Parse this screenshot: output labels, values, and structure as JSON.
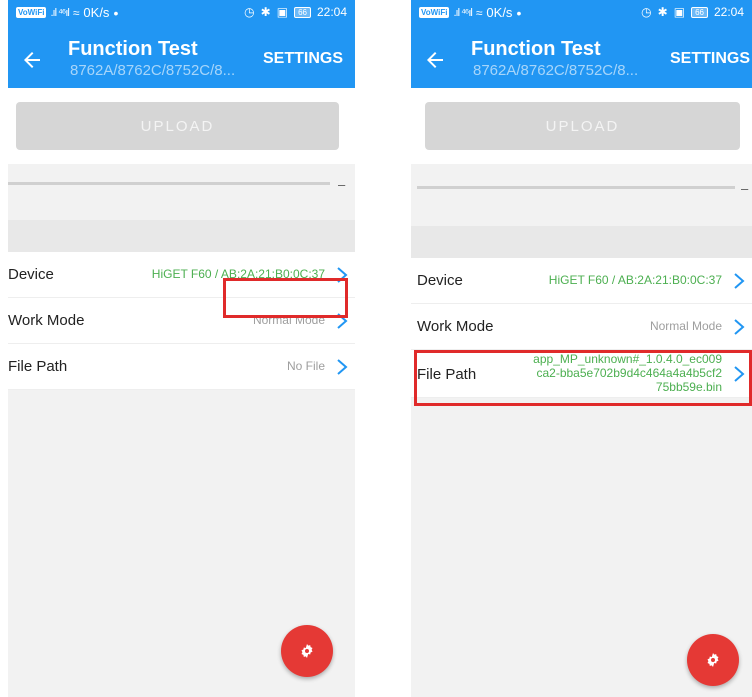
{
  "screens": [
    {
      "status_bar": {
        "volte": "VoWiFi",
        "signal": ".ıl ⁴⁶ıl",
        "net_speed": "0K/s",
        "dot": "•",
        "battery": "66",
        "time": "22:04"
      },
      "app_bar": {
        "title": "Function Test",
        "subtitle": "8762A/8762C/8752C/8...",
        "settings_label": "SETTINGS"
      },
      "upload_label": "UPLOAD",
      "progress_dash": "–",
      "rows": [
        {
          "label": "Device",
          "value": "HiGET F60 / AB:2A:21:B0:0C:37"
        },
        {
          "label": "Work Mode",
          "value": "Normal Mode"
        },
        {
          "label": "File Path",
          "value": "No File"
        }
      ]
    },
    {
      "status_bar": {
        "volte": "VoWiFi",
        "signal": ".ıl ⁴⁶ıl",
        "net_speed": "0K/s",
        "dot": "•",
        "battery": "66",
        "time": "22:04"
      },
      "app_bar": {
        "title": "Function Test",
        "subtitle": "8762A/8762C/8752C/8...",
        "settings_label": "SETTINGS"
      },
      "upload_label": "UPLOAD",
      "progress_dash": "–",
      "rows": [
        {
          "label": "Device",
          "value": "HiGET F60 / AB:2A:21:B0:0C:37"
        },
        {
          "label": "Work Mode",
          "value": "Normal Mode"
        },
        {
          "label": "File Path",
          "value_lines": [
            "app_MP_unknown#_1.0.4.0_ec009",
            "ca2-bba5e702b9d4c464a4a4b5cf2",
            "75bb59e.bin"
          ]
        }
      ]
    }
  ],
  "colors": {
    "accent": "#2196f3",
    "fab": "#e53935",
    "value_green": "#4caf50",
    "highlight": "#e02a2a"
  },
  "icons": [
    "back-arrow-icon",
    "chevron-right-icon",
    "gear-icon",
    "alarm-icon",
    "bluetooth-icon",
    "battery-icon"
  ]
}
